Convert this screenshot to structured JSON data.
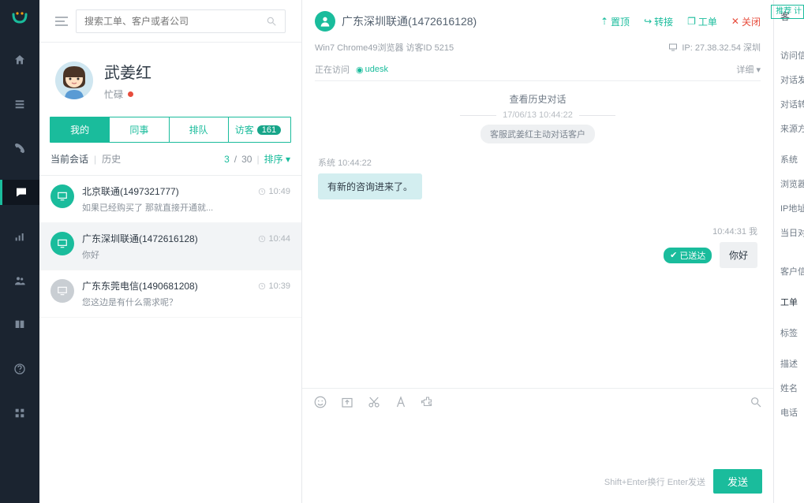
{
  "search_placeholder": "搜索工单、客户或者公司",
  "recommend_badge": "推荐\n  计",
  "profile": {
    "name": "武姜红",
    "status": "忙碌"
  },
  "tabs": {
    "mine": "我的",
    "colleague": "同事",
    "queue": "排队",
    "visitor": "访客",
    "visitor_count": "161"
  },
  "subbar": {
    "current": "当前会话",
    "history": "历史",
    "count_a": "3",
    "count_b": "30",
    "sort": "排序"
  },
  "conversations": [
    {
      "title": "北京联通(1497321777)",
      "msg": "如果已经购买了 那就直接开通就...",
      "time": "10:49",
      "gray": false
    },
    {
      "title": "广东深圳联通(1472616128)",
      "msg": "你好",
      "time": "10:44",
      "gray": false
    },
    {
      "title": "广东东莞电信(1490681208)",
      "msg": "您这边是有什么需求呢？",
      "time": "10:39",
      "gray": true
    }
  ],
  "chat_header": {
    "name": "广东深圳联通(1472616128)",
    "pin": "置顶",
    "transfer": "转接",
    "ticket": "工单",
    "close": "关闭",
    "browser": "Win7 Chrome49浏览器 访客ID 5215",
    "ip": "IP: 27.38.32.54 深圳",
    "visiting": "正在访问",
    "location": "udesk",
    "detail": "详细"
  },
  "chat": {
    "history_link": "查看历史对话",
    "timestamp": "17/06/13 10:44:22",
    "system_chip": "客服武姜红主动对话客户",
    "sys_prefix": "系统",
    "sys_time": "10:44:22",
    "left_msg": "有新的咨询进来了。",
    "right_meta": "10:44:31 我",
    "delivered": "已送达",
    "right_msg": "你好"
  },
  "composer": {
    "hint": "Shift+Enter换行 Enter发送",
    "send": "发送"
  },
  "right_labels": {
    "visitor": "客",
    "visit_info": "访问信",
    "dialog_a": "对话发",
    "dialog_b": "对话转",
    "source": "来源方",
    "system": "系统",
    "browse": "浏览器",
    "ip": "IP地址",
    "today": "当日对",
    "cust": "客户信",
    "ticket": "工单",
    "tag": "标签",
    "desc": "描述",
    "name": "姓名",
    "phone": "电话"
  }
}
